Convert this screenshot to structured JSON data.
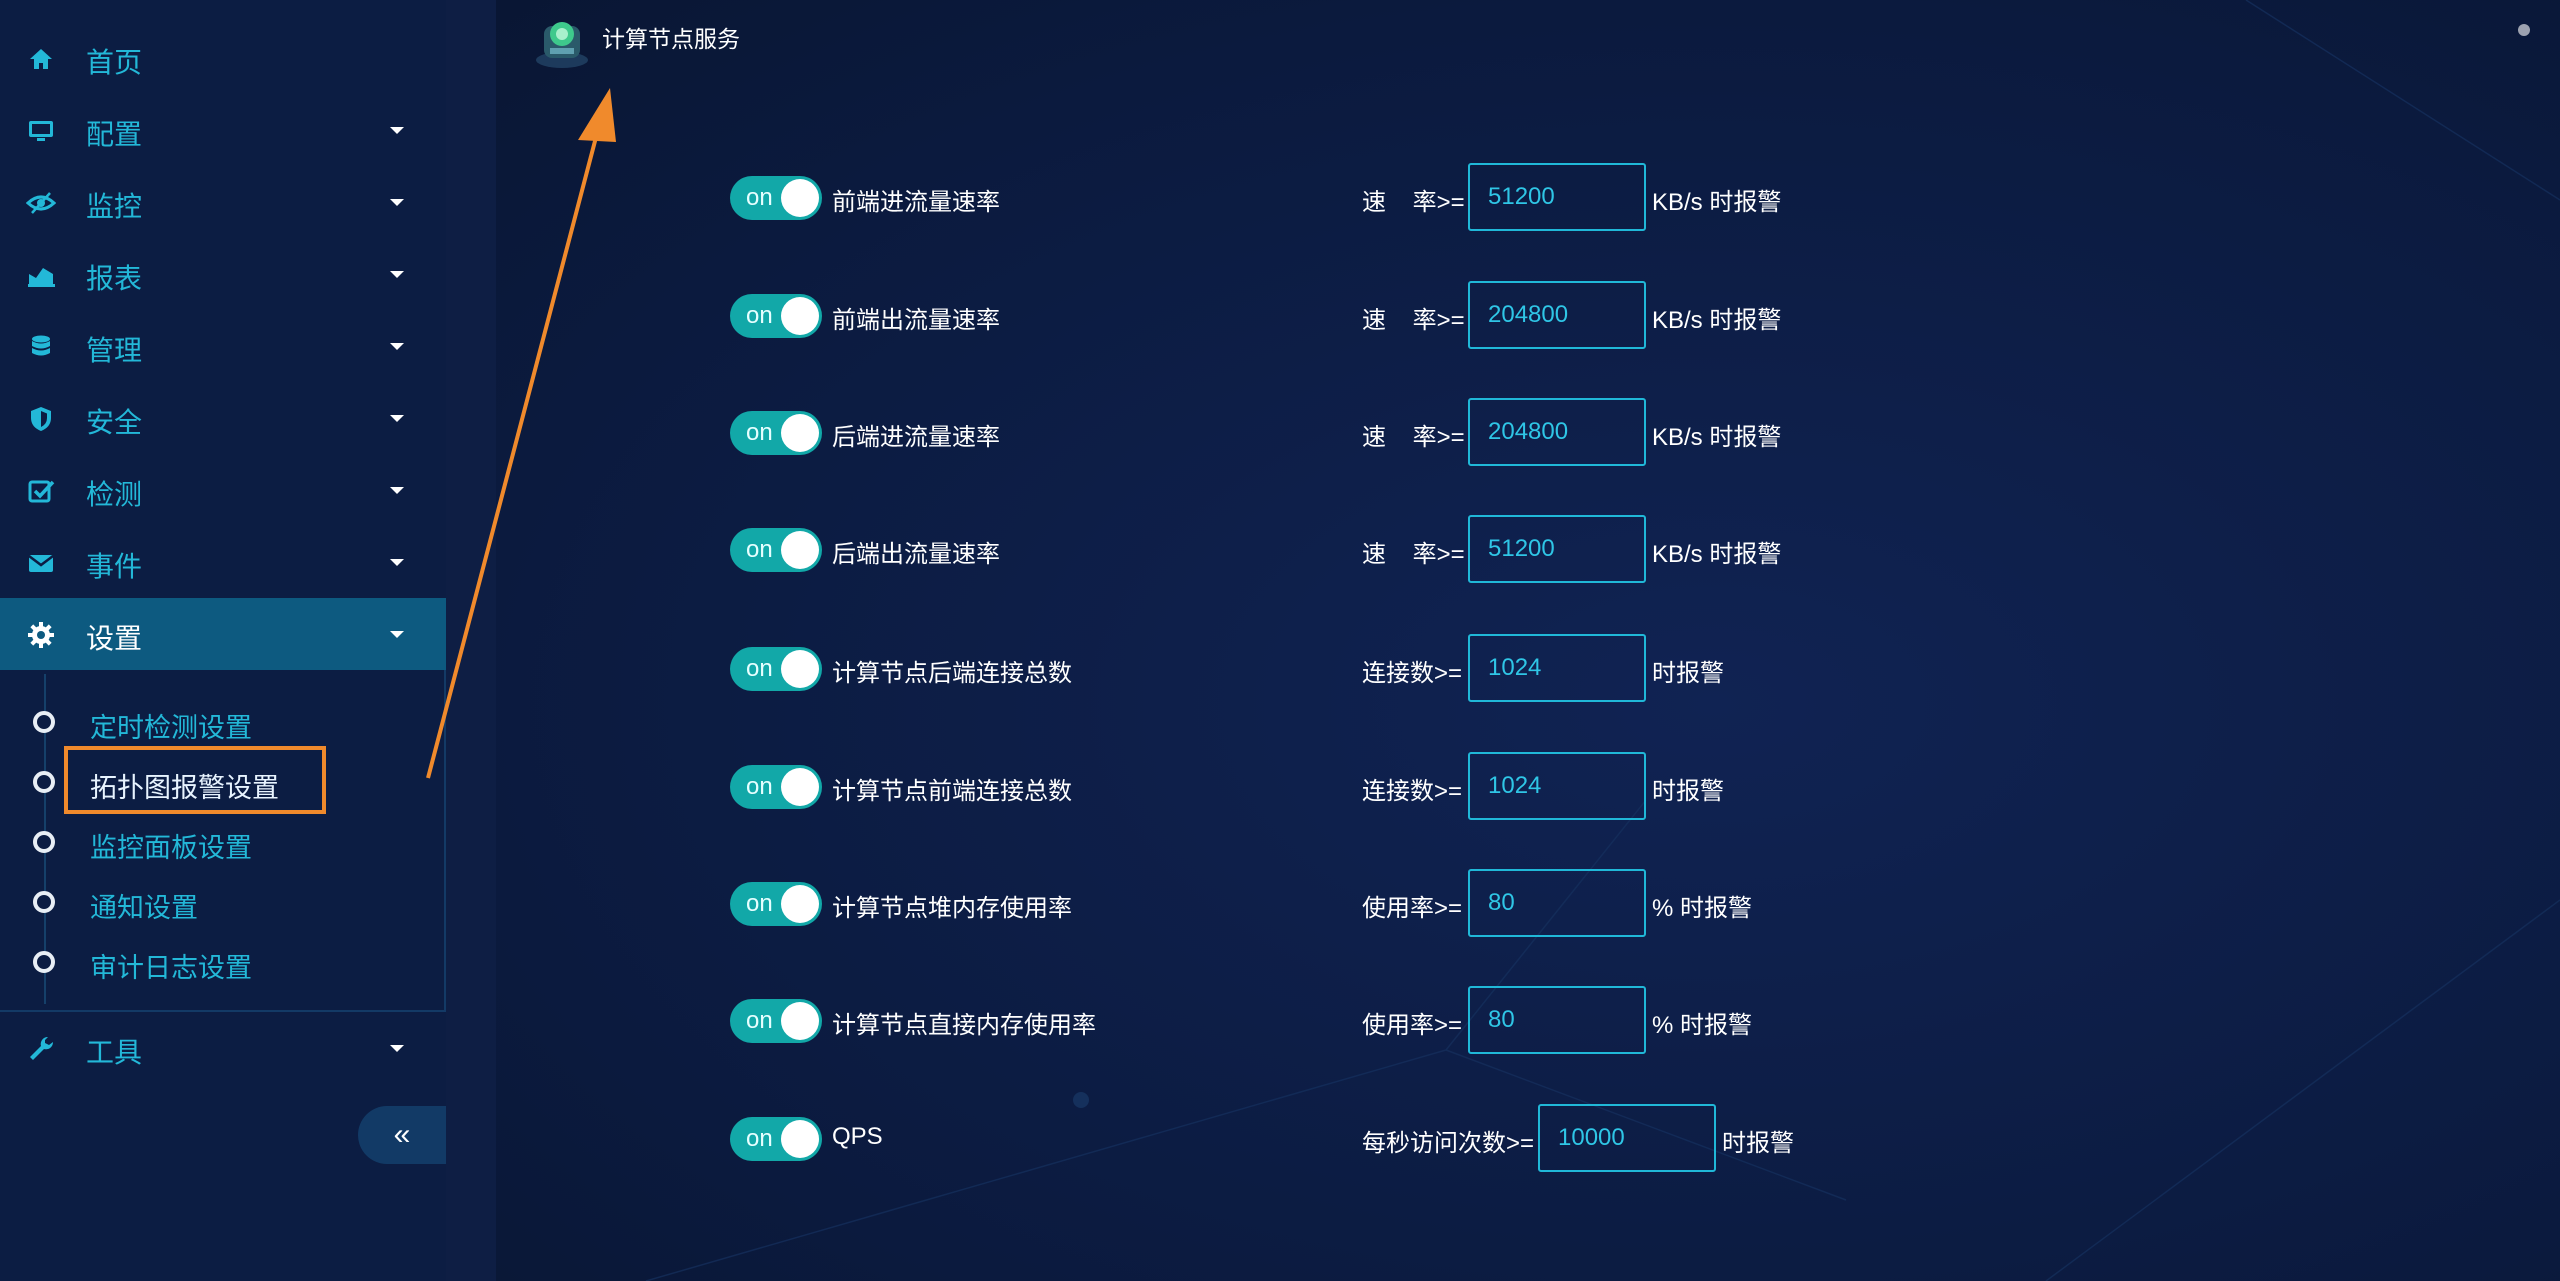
{
  "sidebar": {
    "items": [
      {
        "label": "首页",
        "icon": "home-icon"
      },
      {
        "label": "配置",
        "icon": "monitor-icon"
      },
      {
        "label": "监控",
        "icon": "eye-icon"
      },
      {
        "label": "报表",
        "icon": "area-chart-icon"
      },
      {
        "label": "管理",
        "icon": "database-icon"
      },
      {
        "label": "安全",
        "icon": "shield-icon"
      },
      {
        "label": "检测",
        "icon": "checkbox-icon"
      },
      {
        "label": "事件",
        "icon": "envelope-icon"
      },
      {
        "label": "设置",
        "icon": "gear-icon"
      },
      {
        "label": "工具",
        "icon": "wrench-icon"
      }
    ],
    "submenu": [
      {
        "label": "定时检测设置"
      },
      {
        "label": "拓扑图报警设置"
      },
      {
        "label": "监控面板设置"
      },
      {
        "label": "通知设置"
      },
      {
        "label": "审计日志设置"
      }
    ],
    "collapse_label": "«"
  },
  "header": {
    "title": "计算节点服务"
  },
  "rules": [
    {
      "toggle": "on",
      "metric": "前端进流量速率",
      "condition": "速    率>=",
      "value": "51200",
      "unit": "KB/s 时报警"
    },
    {
      "toggle": "on",
      "metric": "前端出流量速率",
      "condition": "速    率>=",
      "value": "204800",
      "unit": "KB/s 时报警"
    },
    {
      "toggle": "on",
      "metric": "后端进流量速率",
      "condition": "速    率>=",
      "value": "204800",
      "unit": "KB/s 时报警"
    },
    {
      "toggle": "on",
      "metric": "后端出流量速率",
      "condition": "速    率>=",
      "value": "51200",
      "unit": "KB/s 时报警"
    },
    {
      "toggle": "on",
      "metric": "计算节点后端连接总数",
      "condition": "连接数>=",
      "value": "1024",
      "unit": "时报警"
    },
    {
      "toggle": "on",
      "metric": "计算节点前端连接总数",
      "condition": "连接数>=",
      "value": "1024",
      "unit": "时报警"
    },
    {
      "toggle": "on",
      "metric": "计算节点堆内存使用率",
      "condition": "使用率>=",
      "value": "80",
      "unit": "% 时报警"
    },
    {
      "toggle": "on",
      "metric": "计算节点直接内存使用率",
      "condition": "使用率>=",
      "value": "80",
      "unit": "% 时报警"
    },
    {
      "toggle": "on",
      "metric": "QPS",
      "condition": "每秒访问次数>=",
      "value": "10000",
      "unit": "时报警"
    }
  ],
  "colors": {
    "accent": "#23b8d8",
    "toggle_on": "#12a8a8",
    "highlight": "#f08a2c"
  }
}
